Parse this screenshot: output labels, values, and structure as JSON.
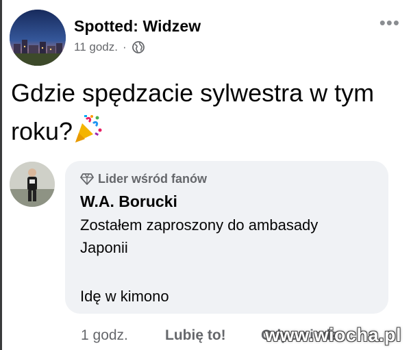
{
  "post": {
    "page_name": "Spotted: Widzew",
    "time": "11 godz.",
    "separator": "·",
    "audience_icon": "globe-icon",
    "more_icon": "more-horizontal-icon",
    "text": "Gdzie spędzacie sylwestra w tym roku?",
    "emoji_icon": "party-popper-icon"
  },
  "comment": {
    "badge_icon": "diamond-icon",
    "badge": "Lider wśród fanów",
    "author": "W.A. Borucki",
    "lines": [
      "Zostałem zaproszony do ambasady",
      "Japonii",
      "",
      "Idę w kimono"
    ],
    "time": "1 godz.",
    "like": "Lubię to!",
    "reply": "Odpowiedz"
  },
  "watermark": "www.wiocha.pl",
  "colors": {
    "text": "#050505",
    "secondary": "#65676b",
    "bubble": "#f0f2f5"
  }
}
